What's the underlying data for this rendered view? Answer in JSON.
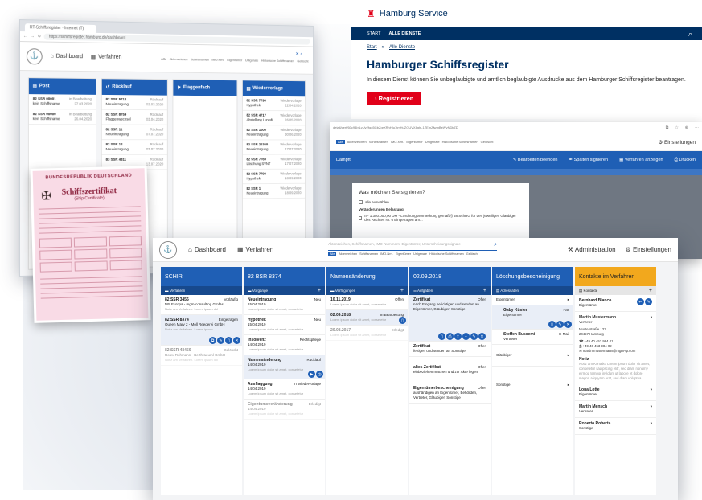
{
  "browser1": {
    "tab": "RT-Schiffsregister · Internet (T)",
    "url": "https://schiffsregister.hamburg.de/dashboard",
    "nav": {
      "dashboard": "Dashboard",
      "verfahren": "Verfahren"
    },
    "filters": [
      "Alle",
      "Aktenzeichen",
      "Schiffsnamen",
      "IMO-Nrn.",
      "Eigentümer",
      "Urligsnale",
      "Historische Schiffsnamen",
      "Gelöscht"
    ],
    "columns": [
      {
        "title": "Post",
        "items": [
          {
            "id": "82 SSR 00001",
            "sub": "kein Schiffsname",
            "status": "in Bearbeitung",
            "date": "27.03.2020"
          },
          {
            "id": "82 SSR 00000",
            "sub": "kein Schiffsname",
            "status": "in Bearbeitung",
            "date": "26.04.2020"
          }
        ]
      },
      {
        "title": "Rücklauf",
        "items": [
          {
            "id": "82 SSR 5712",
            "sub": "Neueintragung",
            "status": "Rücklauf",
            "date": "02.03.2020"
          },
          {
            "id": "82 SSR 8759",
            "sub": "Flaggenwechsel",
            "status": "Rücklauf",
            "date": "03.04.2020"
          },
          {
            "id": "82 SSR 11",
            "sub": "Neueintragung",
            "status": "Rücklauf",
            "date": "07.07.2020"
          },
          {
            "id": "82 SSR 12",
            "sub": "Neueintragung",
            "status": "Rücklauf",
            "date": "07.07.2020"
          },
          {
            "id": "83 SSR 4811",
            "sub": "",
            "status": "Rücklauf",
            "date": "13.07.2020"
          }
        ]
      },
      {
        "title": "Flaggenfach",
        "items": []
      },
      {
        "title": "Wiedervorlage",
        "items": [
          {
            "id": "82 SSR 7790",
            "sub": "Hypothek",
            "status": "Wiedervorlage",
            "date": "22.04.2020"
          },
          {
            "id": "82 SSR 4717",
            "sub": "Abstellung Lunedi",
            "status": "Wiedervorlage",
            "date": "26.05.2020"
          },
          {
            "id": "82 SSR 1000",
            "sub": "Neueintragung",
            "status": "Wiedervorlage",
            "date": "30.06.2020"
          },
          {
            "id": "82 SSR 25360",
            "sub": "Neueintragung",
            "status": "Wiedervorlage",
            "date": "17.07.2020"
          },
          {
            "id": "82 SSR 7769",
            "sub": "Löschung SVNT",
            "status": "Wiedervorlage",
            "date": "17.07.2020"
          },
          {
            "id": "82 SSR 7790",
            "sub": "Hypothek",
            "status": "Wiedervorlage",
            "date": "18.09.2020"
          },
          {
            "id": "82 SSR 1",
            "sub": "Neueintragung",
            "status": "Wiedervorlage",
            "date": "18.09.2020"
          }
        ]
      }
    ]
  },
  "certificate": {
    "header": "BUNDESREPUBLIK DEUTSCHLAND",
    "title": "Schiffszertifikat",
    "subtitle": "(Ship Certificate)"
  },
  "hamburg": {
    "brand_a": "Hamburg",
    "brand_b": "Service",
    "menu": [
      "START",
      "ALLE DIENSTE"
    ],
    "crumb": [
      "Start",
      "Alle Dienste"
    ],
    "title": "Hamburger Schiffsregister",
    "text": "In diesem Dienst können Sie unbeglaubigte und amtlich beglaubigte Ausdrucke aus dem Hamburger Schiffsregister beantragen.",
    "button": "Registrieren"
  },
  "sign": {
    "url": "detail/cert/60c94bfLyUy2fqo5GbZgrXRhHIu1tmHuZGUVX8ghL1ZEmZfwmBeWvNDkZD",
    "settings": "Einstellungen",
    "filters": [
      "Alle",
      "Aktenzeichen",
      "Schiffsnamen",
      "IMO-Nrn.",
      "Eigentümer",
      "Urligsnale",
      "Historische Schiffsnamen",
      "Gelöscht"
    ],
    "toolbar_title": "Dampft",
    "actions": [
      "Bearbeiten beenden",
      "Spalten signieren",
      "Verfahren anzeigen",
      "Drucken"
    ],
    "dialog_title": "Was möchten Sie signieren?",
    "dialog_all": "alle auswählen",
    "dialog_section": "Veränderungen Belastung",
    "dialog_item": "II - 1.350.000,00 DM - Löschungsvormerkung gemäß § 58 SchRG für den jeweiligen Gläubiger des Rechtes Nr. 6 Eingetragen am..."
  },
  "main": {
    "nav": {
      "dashboard": "Dashboard",
      "verfahren": "Verfahren",
      "admin": "Administration",
      "settings": "Einstellungen"
    },
    "search_placeholder": "Aktenzeichen, Schiffsnamen, IMO-Nummern, Eigentümer, Unterscheidungssignale",
    "filters": [
      "Alle",
      "Aktenzeichen",
      "Schiffsnamen",
      "IMO-Nrn.",
      "Eigentümer",
      "Urligsnale",
      "Historische Schiffsnamen",
      "Gelöscht"
    ],
    "col1": {
      "title": "SCHIR",
      "sub": "Verfahren",
      "items": [
        {
          "id": "82 SSR 3456",
          "status": "Vorläufig",
          "desc": "MS Europa - mgm-consulting GmbH",
          "note": "Notiz am Verfahren. Lorem ipsum dol"
        },
        {
          "id": "82 SSR 8374",
          "status": "Eingetragen",
          "desc": "Queen Mary 2 - Moll Reederei GmbH",
          "note": "Notiz am Verfahren. Lorem ipsum"
        },
        {
          "id": "82 SSR 48456",
          "status": "Gelöscht",
          "desc": "Rolex Rohmann - Berthraeuml GmbH",
          "note": "Notiz am Verfahren. Lorem ipsum dol"
        }
      ]
    },
    "col2": {
      "title": "82 BSR 8374",
      "sub": "Vorgänge",
      "items": [
        {
          "name": "Neueintragung",
          "status": "Neu",
          "date": "15.04.2019",
          "note": "Lorem ipsum dolor sit amet, consetetur"
        },
        {
          "name": "Hypothek",
          "status": "Neu",
          "date": "15.04.2019",
          "note": "Lorem ipsum dolor sit amet, consetetur"
        },
        {
          "name": "Insolvenz",
          "status": "Rechtspflege",
          "date": "14.04.2019",
          "note": "Lorem ipsum dolor sit amet, consetetur"
        },
        {
          "name": "Namensänderung",
          "status": "Rücklauf",
          "date": "14.04.2019",
          "note": "Lorem ipsum dolor sit amet, consetetur"
        },
        {
          "name": "Ausflaggung",
          "status": "in Wiedervorlage",
          "date": "14.04.2019",
          "note": "Lorem ipsum dolor sit amet, consetetur"
        },
        {
          "name": "Eigentumsveränderung",
          "status": "Erledigt",
          "date": "14.04.2019",
          "note": "Lorem ipsum dolor sit amet, consetetur"
        }
      ]
    },
    "col3": {
      "title": "Namensänderung",
      "sub": "Verfügungen",
      "items": [
        {
          "date": "10.11.2019",
          "status": "Offen",
          "note": "Lorem ipsum dolor sit amet, consetetur"
        },
        {
          "date": "02.09.2018",
          "status": "In Bearbeitung",
          "note": "Lorem ipsum dolor sit amet, consetetur"
        },
        {
          "date": "20.08.2017",
          "status": "Erledigt",
          "note": "Lorem ipsum dolor sit amet, consetetur"
        }
      ]
    },
    "col4": {
      "title": "02.09.2018",
      "sub": "Aufgaben",
      "items": [
        {
          "name": "Zertifikat",
          "status": "Offen",
          "desc": "nach Eingang berichtigen und senden an Eigentümer, Gläubiger, Sonstige"
        },
        {
          "name": "Zertifikat",
          "status": "Offen",
          "desc": "fertigen und senden an Sonstige"
        },
        {
          "name": "altes Zertifikat",
          "status": "Offen",
          "desc": "einbeziehen machen und zur Akte legen"
        },
        {
          "name": "Eigentümerbescheinigung",
          "status": "Offen",
          "desc": "aushändigen an Eigentümer, Behörden, Vertreter, Gläubiger, Sonstige"
        }
      ]
    },
    "col5": {
      "title": "Löschungsbescheinigung",
      "sub": "Adressaten",
      "items": [
        {
          "name": "Eigentümer",
          "role": "",
          "mode": ""
        },
        {
          "name": "Gaby Küster",
          "role": "Eigentümer",
          "mode": "Fax"
        },
        {
          "name": "Steffen Buscemi",
          "role": "Vertreter",
          "mode": "E-Mail"
        },
        {
          "name": "Gläubiger",
          "role": "",
          "mode": ""
        },
        {
          "name": "Sonstige",
          "role": "",
          "mode": ""
        }
      ]
    },
    "col6": {
      "title": "Kontakte im Verfahren",
      "sub": "Kontakte",
      "items": [
        {
          "name": "Bernhard Blanco",
          "role": "Eigentümer"
        },
        {
          "name": "Martin Mustermann",
          "role": "Vertreter"
        }
      ],
      "address": [
        "Musterstraße 123",
        "20457 Hamburg"
      ],
      "phone": "+49 40 453 984 01",
      "fax": "+49 40 453 984 02",
      "mail": "martin-mustermann@mgm-tp.com",
      "notiz_label": "Notiz",
      "notiz": "Notiz am Kontakt. Lorem ipsum dolor sit amet, consetetur sadipscing elitr, sed diam nonumy eirmod tempor invidunt ut labore et dolore magna aliquyam erat, sed diam voluptua.",
      "more": [
        {
          "name": "Lona Lotte",
          "role": "Eigentümer"
        },
        {
          "name": "Martin Mensch",
          "role": "Vertreter"
        },
        {
          "name": "Roberto Roberta",
          "role": "Sonstige"
        }
      ]
    }
  }
}
